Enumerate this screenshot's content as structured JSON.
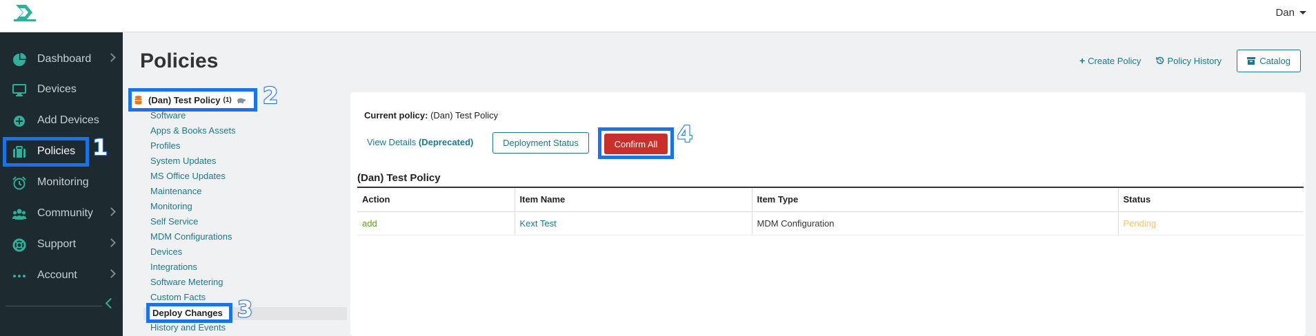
{
  "topbar": {
    "user_name": "Dan"
  },
  "sidebar": {
    "items": [
      {
        "label": "Dashboard",
        "icon": "pie-chart-icon",
        "has_submenu": true
      },
      {
        "label": "Devices",
        "icon": "monitor-icon",
        "has_submenu": false
      },
      {
        "label": "Add Devices",
        "icon": "plus-circle-icon",
        "has_submenu": false
      },
      {
        "label": "Policies",
        "icon": "briefcase-icon",
        "has_submenu": false,
        "active": true
      },
      {
        "label": "Monitoring",
        "icon": "alarm-clock-icon",
        "has_submenu": false
      },
      {
        "label": "Community",
        "icon": "users-icon",
        "has_submenu": true
      },
      {
        "label": "Support",
        "icon": "lifebuoy-icon",
        "has_submenu": true
      },
      {
        "label": "Account",
        "icon": "ellipsis-icon",
        "has_submenu": true
      }
    ]
  },
  "page": {
    "title": "Policies"
  },
  "header_actions": {
    "create_policy": "Create Policy",
    "policy_history": "Policy History",
    "catalog": "Catalog"
  },
  "policy_selector": {
    "name": "(Dan) Test Policy",
    "count": "(1)"
  },
  "policy_nav": {
    "items": [
      "Software",
      "Apps & Books Assets",
      "Profiles",
      "System Updates",
      "MS Office Updates",
      "Maintenance",
      "Monitoring",
      "Self Service",
      "MDM Configurations",
      "Devices",
      "Integrations",
      "Software Metering",
      "Custom Facts"
    ],
    "active": "Deploy Changes",
    "after_active": "History and Events"
  },
  "callouts": [
    "1",
    "2",
    "3",
    "4"
  ],
  "panel": {
    "current_policy_label": "Current policy:",
    "current_policy_value": "(Dan) Test Policy",
    "view_details": "View Details",
    "deprecated": "(Deprecated)",
    "deployment_status": "Deployment Status",
    "confirm_all": "Confirm All",
    "table_title": "(Dan) Test Policy",
    "columns": [
      "Action",
      "Item Name",
      "Item Type",
      "Status"
    ],
    "rows": [
      {
        "action": "add",
        "item_name": "Kext Test",
        "item_type": "MDM Configuration",
        "status": "Pending"
      }
    ]
  },
  "colors": {
    "accent": "#2fb09a",
    "link": "#1a7a8c",
    "danger": "#c9302c",
    "highlight": "#1a73e8",
    "action_add": "#5a9e1a",
    "status_pending": "#f5c46b"
  }
}
